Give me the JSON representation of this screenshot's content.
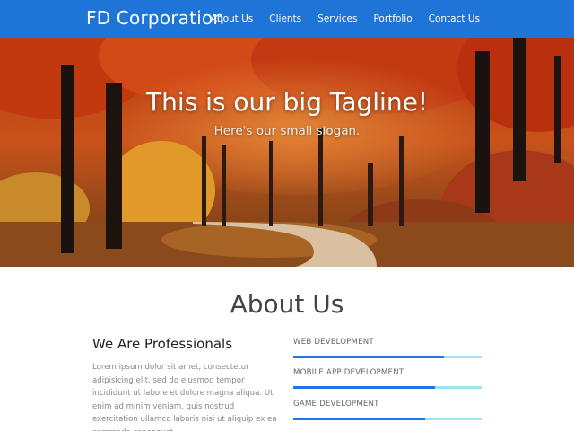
{
  "navbar": {
    "brand": "FD Corporation",
    "links": [
      "About Us",
      "Clients",
      "Services",
      "Portfolio",
      "Contact Us"
    ],
    "bg_color": "#1f74d8"
  },
  "hero": {
    "title": "This is our big Tagline!",
    "slogan": "Here's our small slogan."
  },
  "about": {
    "heading": "About Us",
    "subheading": "We Are Professionals",
    "text": "Lorem ipsum dolor sit amet, consectetur adipisicing elit, sed do eiusmod tempor incididunt ut labore et dolore magna aliqua. Ut enim ad minim veniam, quis nostrud exercitation ullamco laboris nisi ut aliquip ex ea commodo consequat.",
    "skills": [
      {
        "label": "WEB DEVELOPMENT",
        "percent": 80
      },
      {
        "label": "MOBILE APP DEVELOPMENT",
        "percent": 75
      },
      {
        "label": "GAME DEVELOPMENT",
        "percent": 70
      }
    ],
    "bar_fill_color": "#2277dd",
    "bar_track_color": "#9fe3ee"
  }
}
